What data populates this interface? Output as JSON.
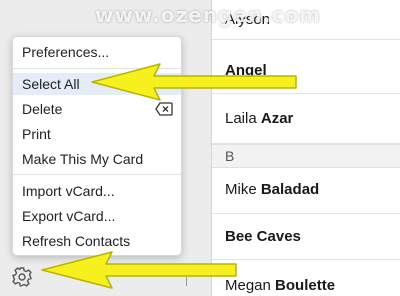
{
  "watermark": "www.ozengen.com",
  "menu": {
    "items": [
      {
        "label": "Preferences..."
      },
      {
        "label": "Select All"
      },
      {
        "label": "Delete"
      },
      {
        "label": "Print"
      },
      {
        "label": "Make This My Card"
      },
      {
        "label": "Import vCard..."
      },
      {
        "label": "Export vCard..."
      },
      {
        "label": "Refresh Contacts"
      }
    ],
    "highlighted": "Select All"
  },
  "contacts": {
    "rows": [
      {
        "first": "Alyson",
        "last": ""
      },
      {
        "first": "",
        "last": "Angel"
      },
      {
        "first": "Laila",
        "last": "Azar"
      },
      {
        "first": "Mike",
        "last": "Baladad"
      },
      {
        "first": "",
        "last": "Bee Caves"
      },
      {
        "first": "Megan",
        "last": "Boulette"
      }
    ],
    "section_b": "B"
  },
  "icons": {
    "gear": "gear-icon",
    "delete_key": "delete-key-icon"
  },
  "colors": {
    "arrow": "#f5f01e",
    "menu_highlight": "#e4ecf7"
  }
}
